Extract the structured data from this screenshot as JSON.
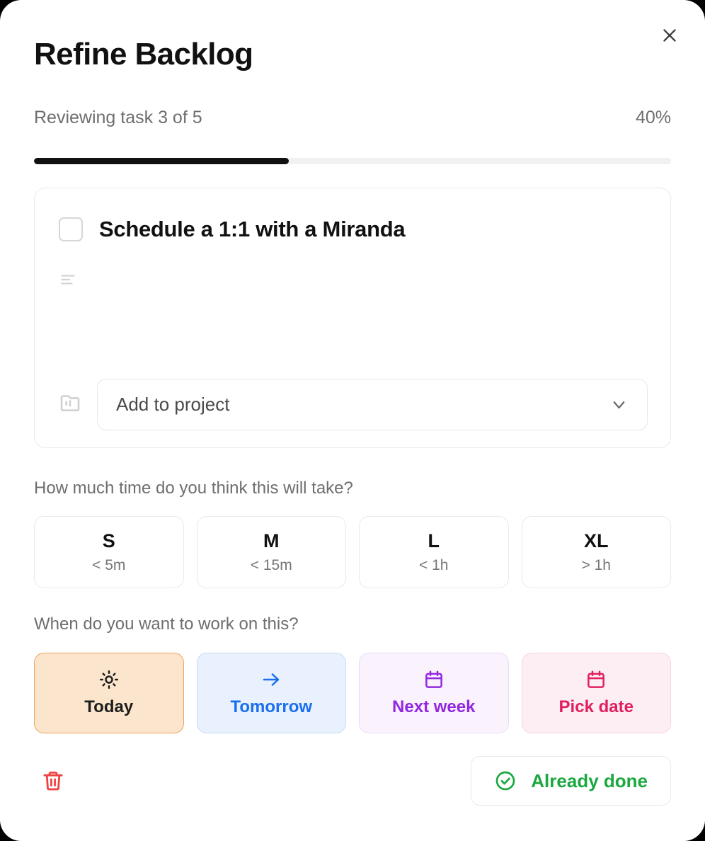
{
  "modal": {
    "title": "Refine Backlog",
    "close_icon": "close-icon",
    "progress": {
      "status_text": "Reviewing task 3 of 5",
      "percent_label": "40%",
      "percent_value": 40
    }
  },
  "task_card": {
    "checkbox_checked": false,
    "title": "Schedule a 1:1 with a Miranda",
    "description_icon": "align-left-icon",
    "description_value": "",
    "description_placeholder": "",
    "project": {
      "icon": "folder-kanban-icon",
      "selected_label": "Add to project",
      "chevron_icon": "chevron-down-icon"
    }
  },
  "time_section": {
    "label": "How much time do you think this will take?",
    "options": [
      {
        "size": "S",
        "duration": "< 5m"
      },
      {
        "size": "M",
        "duration": "< 15m"
      },
      {
        "size": "L",
        "duration": "< 1h"
      },
      {
        "size": "XL",
        "duration": "> 1h"
      }
    ]
  },
  "when_section": {
    "label": "When do you want to work on this?",
    "options": [
      {
        "label": "Today",
        "icon": "sun-icon",
        "color": "#1d1d1d",
        "bg": "#fbe6cd",
        "border": "#f0a35e",
        "selected": true
      },
      {
        "label": "Tomorrow",
        "icon": "arrow-right-icon",
        "color": "#1a6ef0",
        "bg": "#e8f1fd",
        "border": "#c5ddf8",
        "selected": false
      },
      {
        "label": "Next week",
        "icon": "calendar-icon",
        "color": "#9327e0",
        "bg": "#faf3fe",
        "border": "#ead9fb",
        "selected": false
      },
      {
        "label": "Pick date",
        "icon": "calendar-icon",
        "color": "#e01f5e",
        "bg": "#fdeef3",
        "border": "#f8d3e0",
        "selected": false
      }
    ]
  },
  "footer": {
    "delete_icon": "trash-icon",
    "done_icon": "circle-check-icon",
    "done_label": "Already done",
    "done_color": "#1aa83f",
    "delete_color": "#ef4444"
  }
}
